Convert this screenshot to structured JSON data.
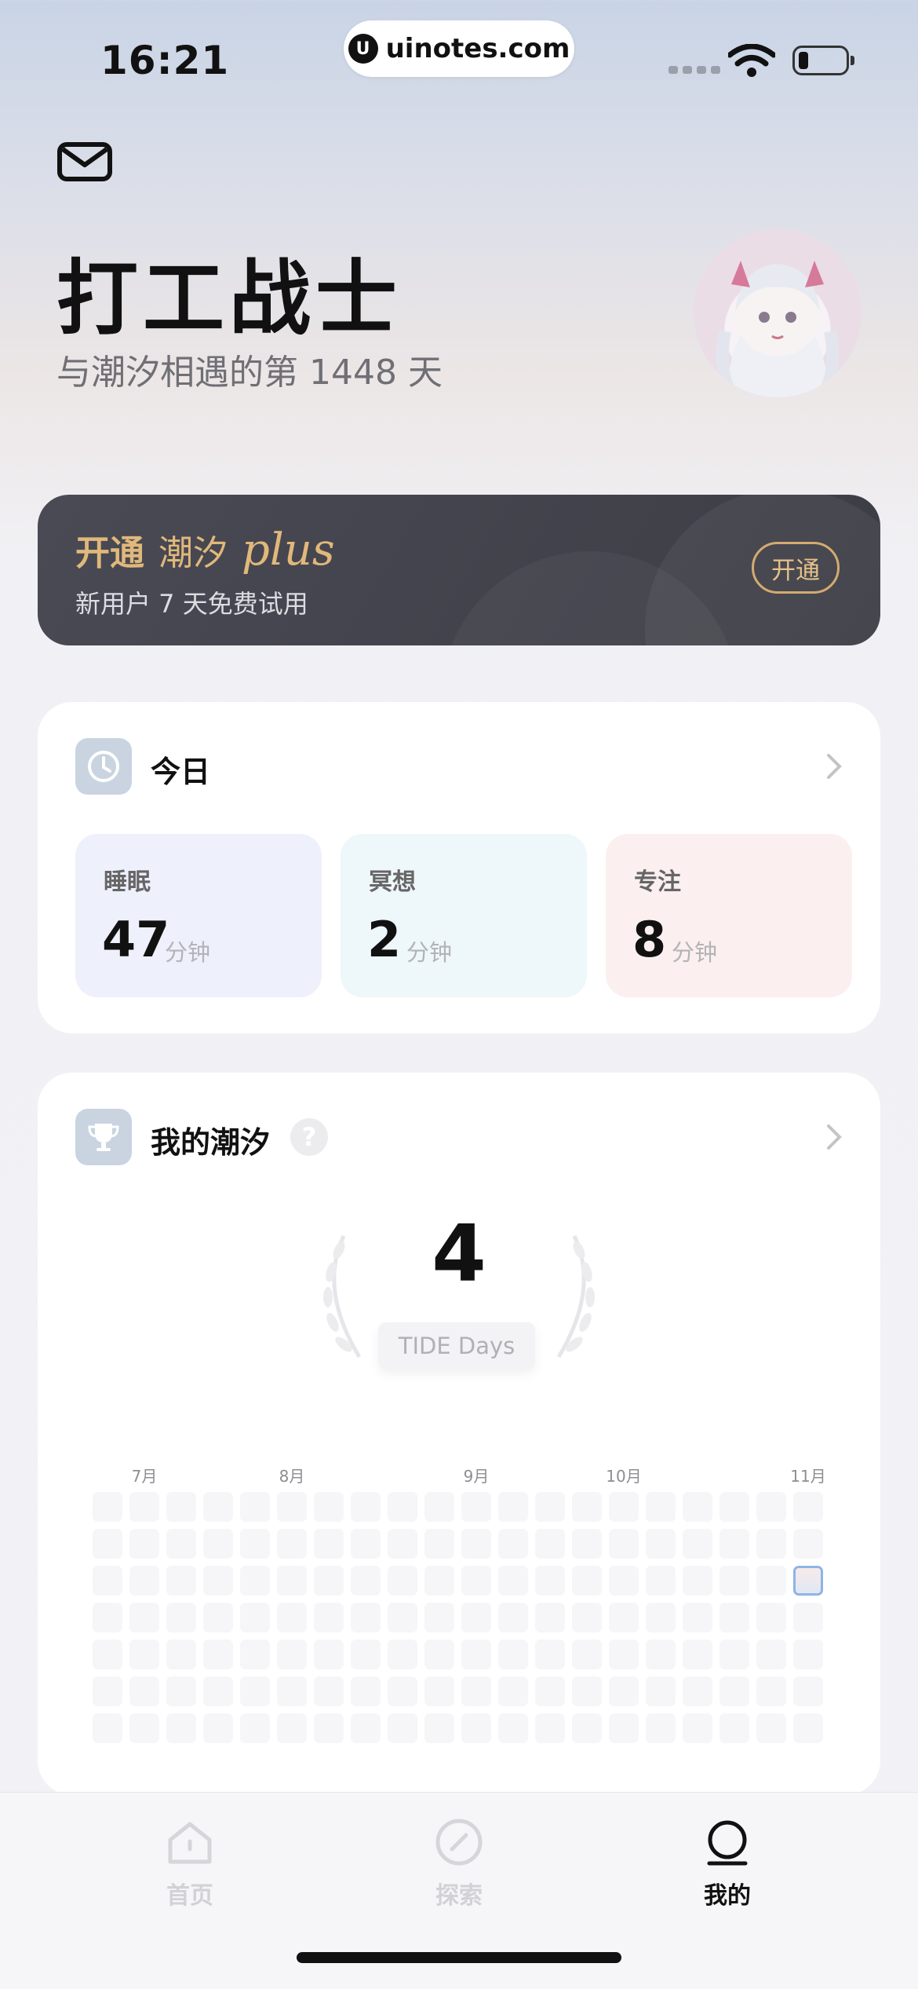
{
  "status_bar": {
    "time": "16:21",
    "url": "uinotes.com",
    "url_logo": "U"
  },
  "header": {
    "name": "打工战士",
    "days_text": "与潮汐相遇的第 1448 天",
    "icons": {
      "mail": "mail-icon",
      "avatar": "avatar"
    }
  },
  "promo": {
    "open": "开通",
    "brand": "潮汐",
    "plus": "plus",
    "subtitle": "新用户 7 天免费试用",
    "button": "开通"
  },
  "today": {
    "title": "今日",
    "icon": "clock-icon",
    "stats": [
      {
        "label": "睡眠",
        "value": "47",
        "unit": "分钟",
        "color": "#eef0fc"
      },
      {
        "label": "冥想",
        "value": "2",
        "unit": "分钟",
        "color": "#eef7fa"
      },
      {
        "label": "专注",
        "value": "8",
        "unit": "分钟",
        "color": "#fcefef"
      }
    ]
  },
  "tide": {
    "title": "我的潮汐",
    "icon": "trophy-icon",
    "help": "?",
    "count": "4",
    "badge": "TIDE Days",
    "months": [
      {
        "label": "7月",
        "col": 1
      },
      {
        "label": "8月",
        "col": 5
      },
      {
        "label": "9月",
        "col": 10
      },
      {
        "label": "10月",
        "col": 14
      },
      {
        "label": "11月",
        "col": 19
      }
    ],
    "heatmap": {
      "columns": 20,
      "rows": 7,
      "active": [
        {
          "col": 19,
          "row": 2
        }
      ]
    }
  },
  "tabbar": {
    "tabs": [
      {
        "label": "首页",
        "icon": "home-icon",
        "active": false
      },
      {
        "label": "探索",
        "icon": "compass-icon",
        "active": false
      },
      {
        "label": "我的",
        "icon": "profile-icon",
        "active": true
      }
    ]
  },
  "colors": {
    "accent_gold": "#e0b87a",
    "banner_dark": "#45454e",
    "today_outline": "#8fb4e4"
  }
}
